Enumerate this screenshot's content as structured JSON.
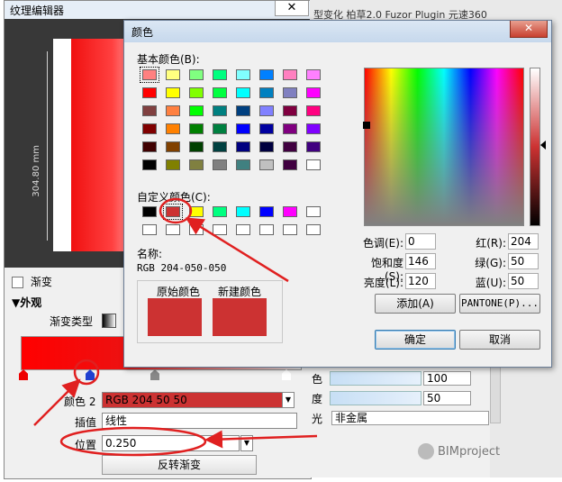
{
  "texture_editor": {
    "title": "纹理编辑器",
    "close_glyph": "✕",
    "dimension_text": "304.80 mm",
    "gradient_checkbox_label": "渐变",
    "appearance_header": "▼外观",
    "gradient_type_label": "渐变类型",
    "color_label": "颜色 2",
    "color_value": "RGB 204 50 50",
    "interpolation_label": "插值",
    "interpolation_value": "线性",
    "position_label": "位置",
    "position_value": "0.250",
    "reverse_button": "反转渐变"
  },
  "right_panel": {
    "tabs_text": "型变化   柏草2.0   Fuzor Plugin   元速360",
    "row1_label": "色",
    "row1_value": "100",
    "row2_label": "度",
    "row2_value": "50",
    "row3_label": "光",
    "row3_value": "非金属"
  },
  "watermark": "BIMproject",
  "color_dialog": {
    "title": "颜色",
    "close_glyph": "✕",
    "basic_colors_label": "基本颜色(B):",
    "custom_colors_label": "自定义颜色(C):",
    "name_label": "名称:",
    "rgb_name": "RGB 204-050-050",
    "original_label": "原始颜色",
    "new_label": "新建颜色",
    "original_color": "#cc3232",
    "new_color": "#cc3232",
    "hue_label": "色调(E):",
    "hue_value": "0",
    "sat_label": "饱和度(S):",
    "sat_value": "146",
    "lum_label": "亮度(L):",
    "lum_value": "120",
    "red_label": "红(R):",
    "red_value": "204",
    "green_label": "绿(G):",
    "green_value": "50",
    "blue_label": "蓝(U):",
    "blue_value": "50",
    "add_button": "添加(A)",
    "pantone_button": "PANTONE(P)...",
    "ok_button": "确定",
    "cancel_button": "取消",
    "basic_colors": [
      "#ff8080",
      "#ffff80",
      "#80ff80",
      "#00ff80",
      "#80ffff",
      "#0080ff",
      "#ff80c0",
      "#ff80ff",
      "#ff0000",
      "#ffff00",
      "#80ff00",
      "#00ff40",
      "#00ffff",
      "#0080c0",
      "#8080c0",
      "#ff00ff",
      "#804040",
      "#ff8040",
      "#00ff00",
      "#008080",
      "#004080",
      "#8080ff",
      "#800040",
      "#ff0080",
      "#800000",
      "#ff8000",
      "#008000",
      "#008040",
      "#0000ff",
      "#0000a0",
      "#800080",
      "#8000ff",
      "#400000",
      "#804000",
      "#004000",
      "#004040",
      "#000080",
      "#000040",
      "#400040",
      "#400080",
      "#000000",
      "#808000",
      "#808040",
      "#808080",
      "#408080",
      "#c0c0c0",
      "#400040",
      "#ffffff"
    ],
    "custom_colors": [
      "#000000",
      "#cc3232",
      "#ffff00",
      "#00ff80",
      "#00ffff",
      "#0000ff",
      "#ff00ff",
      "#ffffff",
      "#ffffff",
      "#ffffff",
      "#ffffff",
      "#ffffff",
      "#ffffff",
      "#ffffff",
      "#ffffff",
      "#ffffff"
    ]
  }
}
